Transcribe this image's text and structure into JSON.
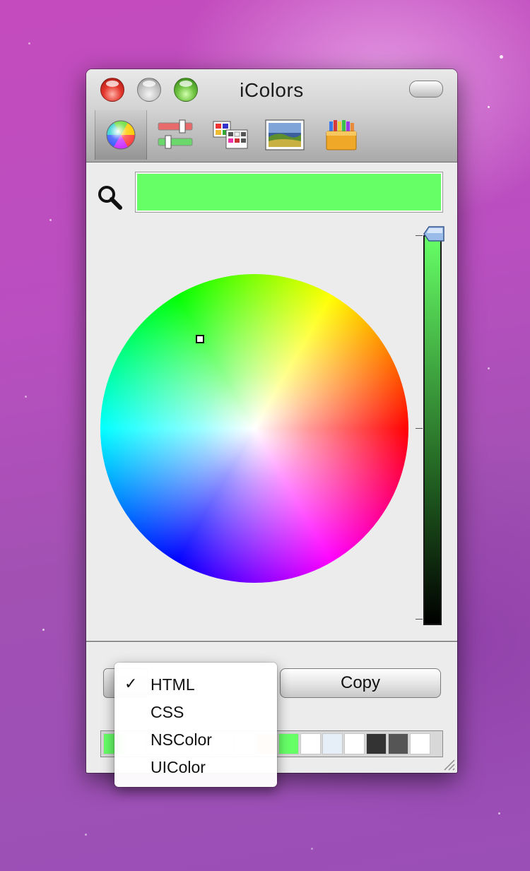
{
  "window": {
    "title": "iColors",
    "toolbar": [
      {
        "name": "color-wheel-tab",
        "icon": "color-wheel-icon",
        "selected": true
      },
      {
        "name": "sliders-tab",
        "icon": "sliders-icon",
        "selected": false
      },
      {
        "name": "palettes-tab",
        "icon": "palettes-icon",
        "selected": false
      },
      {
        "name": "image-tab",
        "icon": "image-icon",
        "selected": false
      },
      {
        "name": "crayons-tab",
        "icon": "crayons-icon",
        "selected": false
      }
    ]
  },
  "color": {
    "current": "#66ff66",
    "brightness": 1.0
  },
  "actions": {
    "copy_label": "Copy"
  },
  "format_menu": {
    "checkmark": "✓",
    "items": [
      {
        "label": "HTML",
        "checked": true
      },
      {
        "label": "CSS",
        "checked": false
      },
      {
        "label": "NSColor",
        "checked": false
      },
      {
        "label": "UIColor",
        "checked": false
      }
    ]
  },
  "swatches": [
    "#66ff66",
    "#ffffff",
    "#ffffff",
    "#ffffff",
    "#ffffff",
    "#ffffff",
    "#ffffff",
    "#e8a060",
    "#66ff66",
    "#ffffff",
    "#e6eef8",
    "#ffffff",
    "#333333",
    "#555555",
    "#ffffff"
  ]
}
